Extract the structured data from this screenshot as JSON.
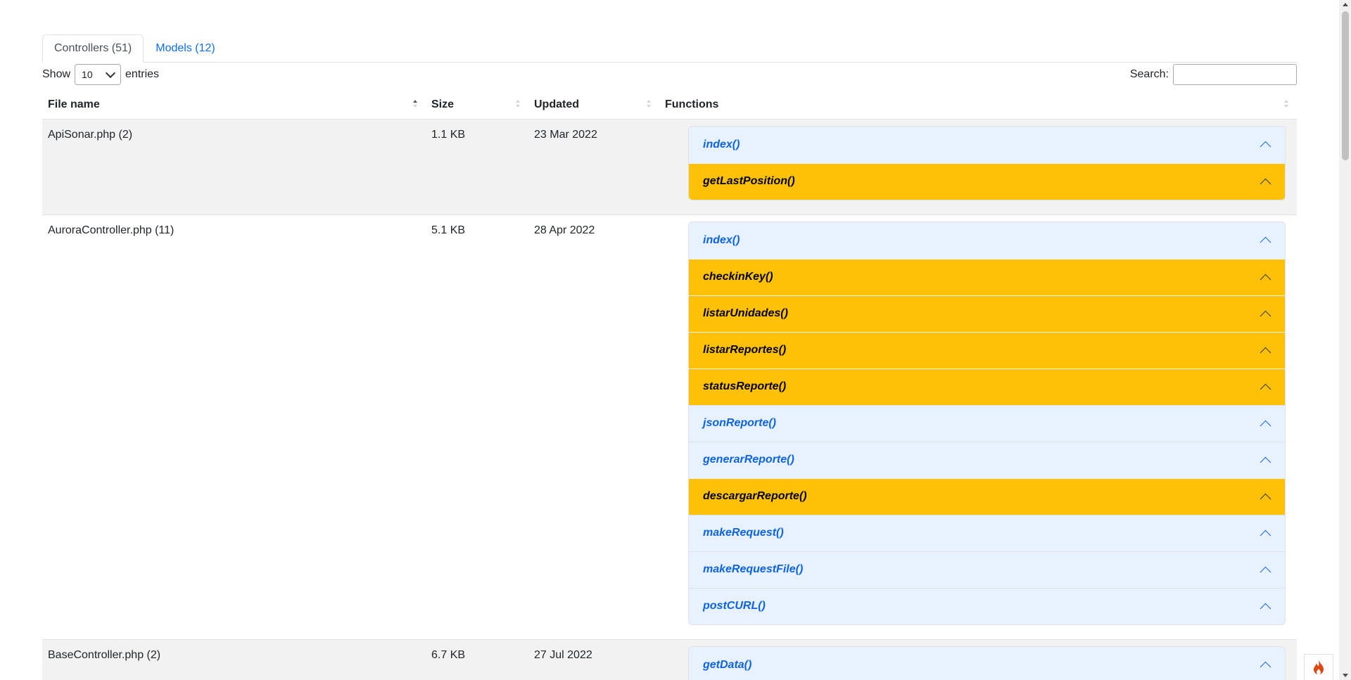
{
  "tabs": [
    {
      "label": "Controllers (51)",
      "active": true
    },
    {
      "label": "Models (12)",
      "active": false
    }
  ],
  "length_control": {
    "prefix": "Show",
    "selected": "10",
    "suffix": "entries"
  },
  "search": {
    "label": "Search:",
    "value": ""
  },
  "table": {
    "headers": [
      "File name",
      "Size",
      "Updated",
      "Functions"
    ],
    "rows": [
      {
        "file": "ApiSonar.php (2)",
        "size": "1.1 KB",
        "updated": "23 Mar 2022",
        "functions": [
          {
            "name": "index()",
            "color": "blue"
          },
          {
            "name": "getLastPosition()",
            "color": "yellow"
          }
        ]
      },
      {
        "file": "AuroraController.php (11)",
        "size": "5.1 KB",
        "updated": "28 Apr 2022",
        "functions": [
          {
            "name": "index()",
            "color": "blue"
          },
          {
            "name": "checkinKey()",
            "color": "yellow"
          },
          {
            "name": "listarUnidades()",
            "color": "yellow"
          },
          {
            "name": "listarReportes()",
            "color": "yellow"
          },
          {
            "name": "statusReporte()",
            "color": "yellow"
          },
          {
            "name": "jsonReporte()",
            "color": "blue"
          },
          {
            "name": "generarReporte()",
            "color": "blue"
          },
          {
            "name": "descargarReporte()",
            "color": "yellow"
          },
          {
            "name": "makeRequest()",
            "color": "blue"
          },
          {
            "name": "makeRequestFile()",
            "color": "blue"
          },
          {
            "name": "postCURL()",
            "color": "blue"
          }
        ]
      },
      {
        "file": "BaseController.php (2)",
        "size": "6.7 KB",
        "updated": "27 Jul 2022",
        "functions": [
          {
            "name": "getData()",
            "color": "blue"
          }
        ]
      }
    ]
  },
  "colors": {
    "accordion_blue_bg": "#e7f1ff",
    "accordion_blue_text": "#0c63e4",
    "accordion_yellow_bg": "#ffc107",
    "row_stripe": "#f2f2f2",
    "link": "#0d6efd"
  },
  "icons": {
    "accordion_toggle": "chevron-up-icon",
    "select_toggle": "chevron-down-icon",
    "corner_badge": "flame-icon"
  }
}
